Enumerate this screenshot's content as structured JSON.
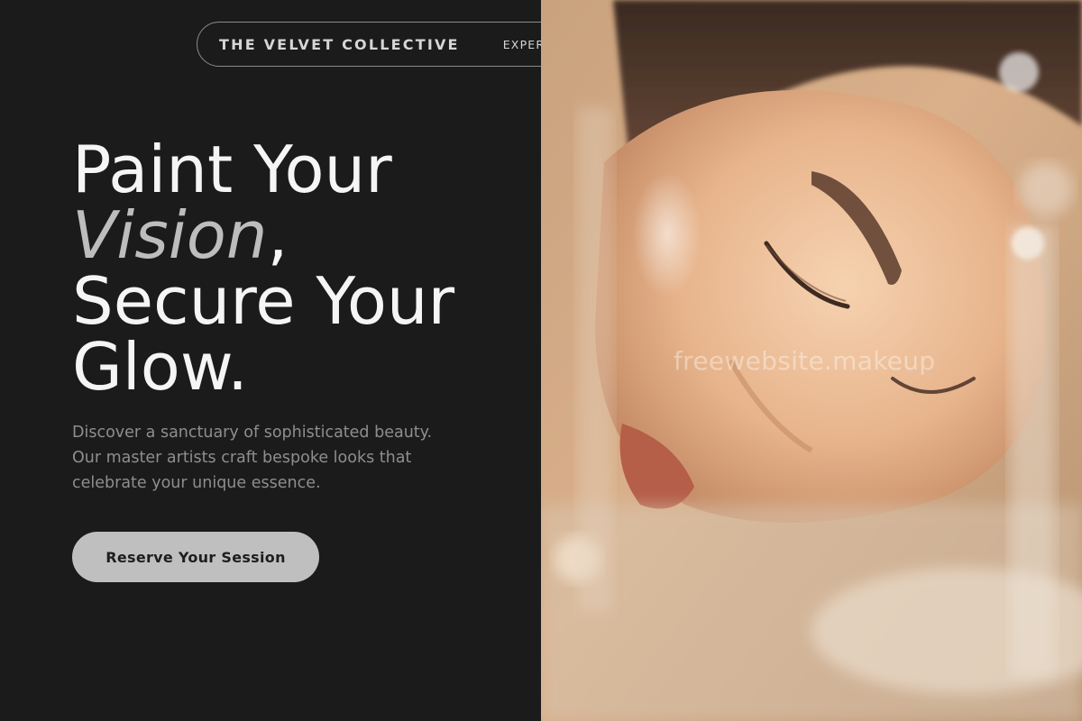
{
  "nav": {
    "brand": "THE VELVET COLLECTIVE",
    "links": [
      "EXPERTI"
    ]
  },
  "hero": {
    "title_line1": "Paint Your",
    "title_accent": "Vision",
    "title_comma": ",",
    "title_line3": "Secure Your",
    "title_line4": "Glow.",
    "subtitle": "Discover a sanctuary of sophisticated beauty. Our master artists craft bespoke looks that celebrate your unique essence.",
    "cta_label": "Reserve Your Session"
  },
  "photo": {
    "subject": "close-up portrait of a woman with closed eyes in warm light",
    "watermark": "freewebsite.makeup"
  },
  "colors": {
    "background": "#1b1b1b",
    "title": "#f5f5f5",
    "accent": "#bdbdbd",
    "subtitle": "#8e8e8e",
    "cta_bg": "#bfbfbf",
    "cta_text": "#1e1e1e"
  }
}
